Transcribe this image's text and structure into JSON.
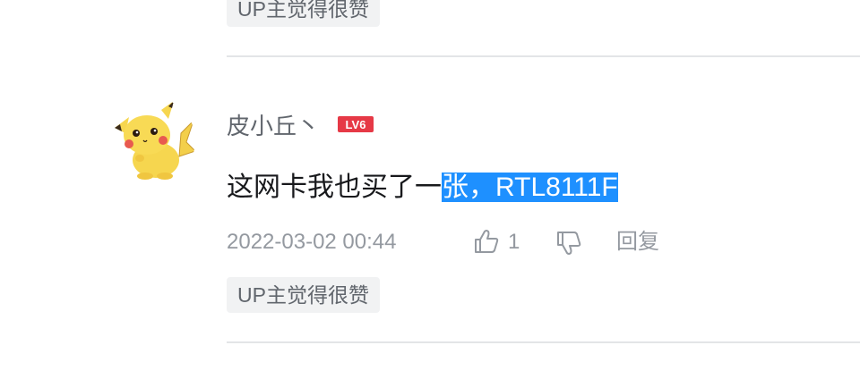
{
  "previous_comment": {
    "tag": "UP主觉得很赞"
  },
  "comment": {
    "username": "皮小丘丶",
    "level_badge": "LV6",
    "content_plain": "这网卡我也买了一",
    "content_selected": "张，RTL8111F",
    "timestamp": "2022-03-02 00:44",
    "like_count": "1",
    "reply_label": "回复",
    "tag": "UP主觉得很赞"
  },
  "icons": {
    "like": "thumbs-up-icon",
    "dislike": "thumbs-down-icon"
  },
  "colors": {
    "selection": "#1e90ff",
    "level_badge": "#e63946",
    "meta_text": "#9499a0",
    "tag_bg": "#f1f2f3"
  }
}
